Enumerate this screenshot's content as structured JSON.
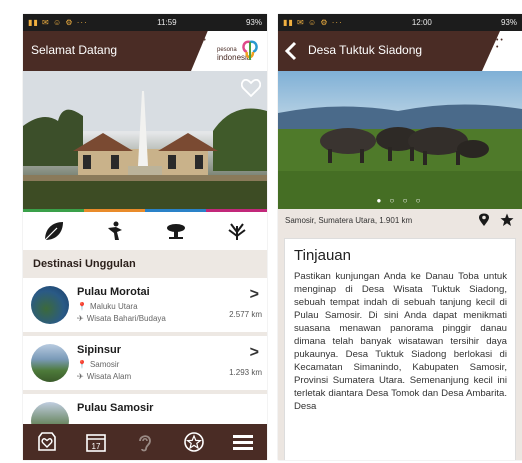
{
  "left": {
    "status": {
      "time": "11:59",
      "battery": "93%"
    },
    "appbar": {
      "title": "Selamat Datang"
    },
    "logo": {
      "brand": "pesona",
      "brand2": "indonesia"
    },
    "section_title": "Destinasi Unggulan",
    "destinations": [
      {
        "name": "Pulau Morotai",
        "region": "Maluku Utara",
        "category": "Wisata Bahari/Budaya",
        "distance": "2.577 km"
      },
      {
        "name": "Sipinsur",
        "region": "Samosir",
        "category": "Wisata Alam",
        "distance": "1.293 km"
      },
      {
        "name": "Pulau Samosir"
      }
    ],
    "bottom_nav": [
      "favorites-icon",
      "calendar-icon",
      "ear-icon",
      "star-icon",
      "menu-icon"
    ],
    "calendar_day": "17"
  },
  "right": {
    "status": {
      "time": "12:00",
      "battery": "93%"
    },
    "appbar": {
      "title": "Desa Tuktuk Siadong"
    },
    "location": "Samosir, Sumatera Utara, 1.901 km",
    "overview_title": "Tinjauan",
    "overview_text": "Pastikan kunjungan Anda ke Danau Toba untuk menginap di Desa Wisata Tuktuk Siadong, sebuah tempat indah di sebuah tanjung kecil di Pulau Samosir. Di sini Anda dapat menikmati suasana menawan panorama pinggir danau dimana telah banyak wisatawan tersihir daya pukaunya. Desa Tuktuk Siadong berlokasi di Kecamatan Simanindo, Kabupaten Samosir, Provinsi Sumatera Utara. Semenanjung kecil ini terletak diantara Desa Tomok dan Desa Ambarita. Desa"
  },
  "colors": {
    "brand": "#4a2c25",
    "strip": [
      "#3aa04a",
      "#e98b2a",
      "#2a82c8",
      "#c2287a"
    ]
  }
}
